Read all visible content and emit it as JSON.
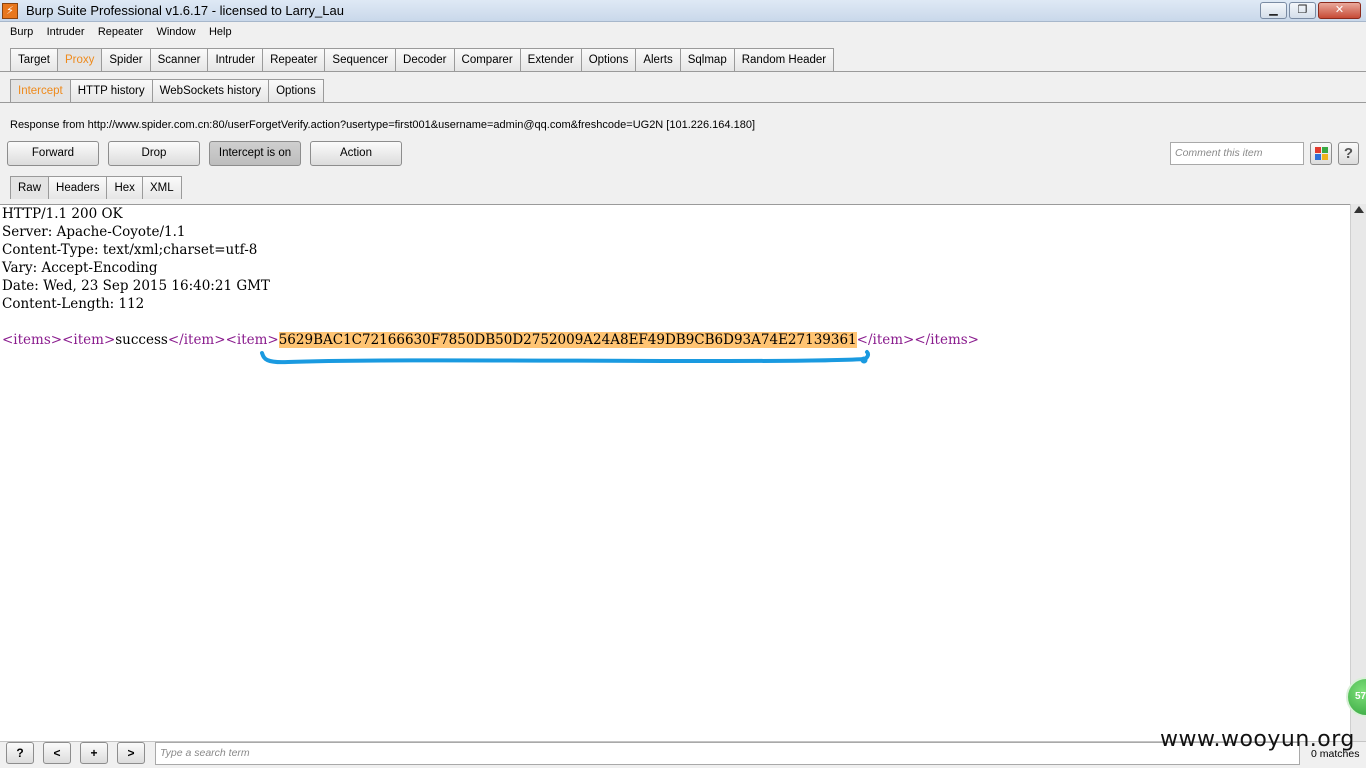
{
  "window": {
    "title": "Burp Suite Professional v1.6.17 - licensed to Larry_Lau",
    "icon_letter": "⚡",
    "minimize": "▁",
    "maximize": "❐",
    "close": "✕"
  },
  "menu": [
    "Burp",
    "Intruder",
    "Repeater",
    "Window",
    "Help"
  ],
  "main_tabs": [
    "Target",
    "Proxy",
    "Spider",
    "Scanner",
    "Intruder",
    "Repeater",
    "Sequencer",
    "Decoder",
    "Comparer",
    "Extender",
    "Options",
    "Alerts",
    "Sqlmap",
    "Random Header"
  ],
  "main_tab_active": "Proxy",
  "proxy_tabs": [
    "Intercept",
    "HTTP history",
    "WebSockets history",
    "Options"
  ],
  "proxy_tab_active": "Intercept",
  "intercept": {
    "response_info": "Response from http://www.spider.com.cn:80/userForgetVerify.action?usertype=first001&username=admin@qq.com&freshcode=UG2N  [101.226.164.180]",
    "forward": "Forward",
    "drop": "Drop",
    "intercept_toggle": "Intercept is on",
    "action": "Action",
    "comment_placeholder": "Comment this item",
    "help": "?"
  },
  "view_tabs": [
    "Raw",
    "Headers",
    "Hex",
    "XML"
  ],
  "view_tab_active": "Raw",
  "response": {
    "headers": [
      "HTTP/1.1 200 OK",
      "Server: Apache-Coyote/1.1",
      "Content-Type: text/xml;charset=utf-8",
      "Vary: Accept-Encoding",
      "Date: Wed, 23 Sep 2015 16:40:21 GMT",
      "Content-Length: 112"
    ],
    "body": {
      "open_items": "<items>",
      "open_item1": "<item>",
      "value1": "success",
      "close_item1": "</item>",
      "open_item2": "<item>",
      "value2": "5629BAC1C72166630F7850DB50D2752009A24A8EF49DB9CB6D93A74E27139361",
      "close_item2": "</item>",
      "close_items": "</items>"
    }
  },
  "search": {
    "help": "?",
    "prev": "<",
    "add": "+",
    "next": ">",
    "placeholder": "Type a search term",
    "matches": "0 matches"
  },
  "badge": "57",
  "watermark": "www.wooyun.org",
  "colors": {
    "active_tab": "#ee8a1c",
    "xml_tag": "#8a1c8e",
    "highlight": "#ffc473",
    "annotation": "#1a9ae0"
  }
}
